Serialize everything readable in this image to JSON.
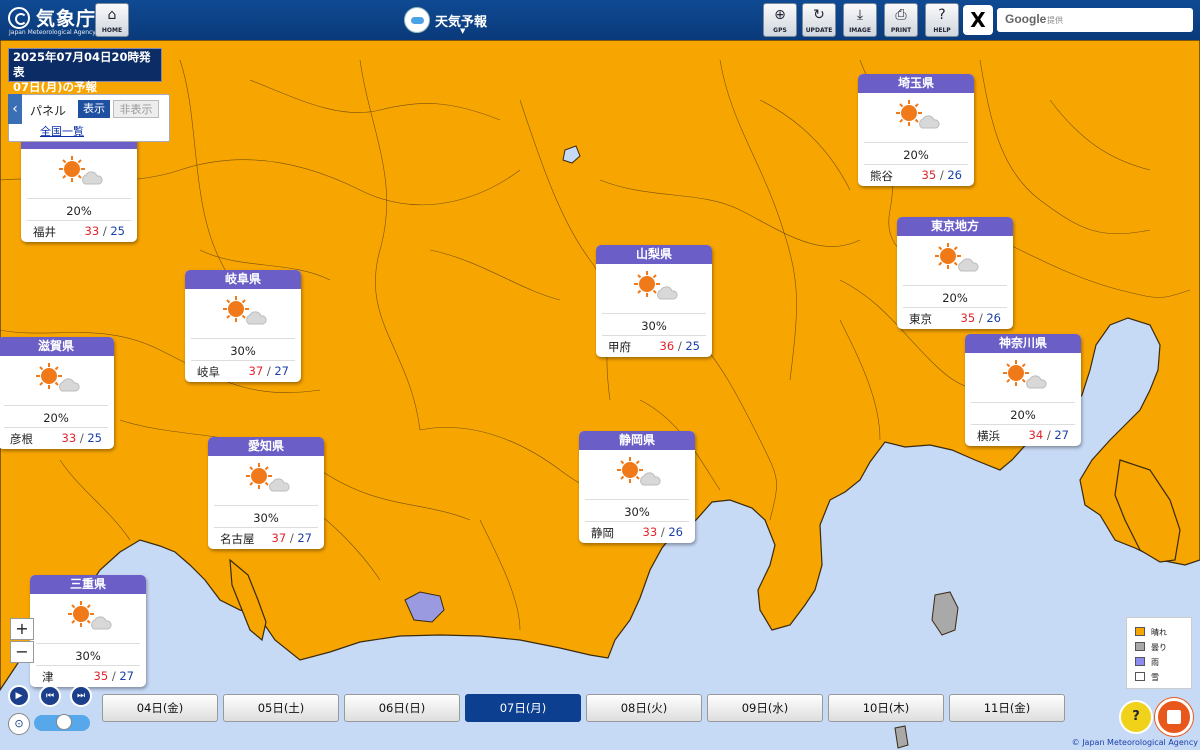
{
  "header": {
    "logo_jp": "気象庁",
    "logo_en": "Japan Meteorological Agency",
    "forecast_title": "天気予報",
    "tools": [
      {
        "label": "HOME",
        "icon": "home-icon",
        "glyph": "⌂"
      },
      {
        "label": "GPS",
        "icon": "gps-icon",
        "glyph": "⊕"
      },
      {
        "label": "UPDATE",
        "icon": "update-icon",
        "glyph": "↻"
      },
      {
        "label": "IMAGE",
        "icon": "download-icon",
        "glyph": "⤓"
      },
      {
        "label": "PRINT",
        "icon": "print-icon",
        "glyph": "⎙"
      },
      {
        "label": "HELP",
        "icon": "help-icon",
        "glyph": "?"
      }
    ],
    "x_label": "X",
    "search_brand": "Google",
    "search_sub": "提供"
  },
  "issued": {
    "line1": "2025年07月04日20時発表",
    "line2": "07日(月)の予報"
  },
  "panel": {
    "label": "パネル",
    "show": "表示",
    "hide": "非表示",
    "list_link": "全国一覧",
    "collapse_glyph": "‹"
  },
  "cards": [
    {
      "pref": "",
      "city": "福井",
      "pop": "20%",
      "max": "33",
      "min": "25",
      "weather": "sunny-partly-cloudy"
    },
    {
      "pref": "埼玉県",
      "city": "熊谷",
      "pop": "20%",
      "max": "35",
      "min": "26",
      "weather": "sunny-partly-cloudy"
    },
    {
      "pref": "東京地方",
      "city": "東京",
      "pop": "20%",
      "max": "35",
      "min": "26",
      "weather": "sunny-partly-cloudy"
    },
    {
      "pref": "山梨県",
      "city": "甲府",
      "pop": "30%",
      "max": "36",
      "min": "25",
      "weather": "sunny-partly-cloudy"
    },
    {
      "pref": "岐阜県",
      "city": "岐阜",
      "pop": "30%",
      "max": "37",
      "min": "27",
      "weather": "sunny-partly-cloudy"
    },
    {
      "pref": "滋賀県",
      "city": "彦根",
      "pop": "20%",
      "max": "33",
      "min": "25",
      "weather": "sunny-partly-cloudy"
    },
    {
      "pref": "神奈川県",
      "city": "横浜",
      "pop": "20%",
      "max": "34",
      "min": "27",
      "weather": "sunny-partly-cloudy"
    },
    {
      "pref": "静岡県",
      "city": "静岡",
      "pop": "30%",
      "max": "33",
      "min": "26",
      "weather": "sunny-partly-cloudy"
    },
    {
      "pref": "愛知県",
      "city": "名古屋",
      "pop": "30%",
      "max": "37",
      "min": "27",
      "weather": "sunny-partly-cloudy"
    },
    {
      "pref": "三重県",
      "city": "津",
      "pop": "30%",
      "max": "35",
      "min": "27",
      "weather": "sunny-partly-cloudy"
    }
  ],
  "temp_separator": "/",
  "zoom": {
    "in": "+",
    "out": "−"
  },
  "playback": {
    "play": "▶",
    "prev": "⏮",
    "next": "⏭"
  },
  "date_tabs": [
    {
      "label": "04日(金)",
      "active": false
    },
    {
      "label": "05日(土)",
      "active": false
    },
    {
      "label": "06日(日)",
      "active": false
    },
    {
      "label": "07日(月)",
      "active": true
    },
    {
      "label": "08日(火)",
      "active": false
    },
    {
      "label": "09日(水)",
      "active": false
    },
    {
      "label": "10日(木)",
      "active": false
    },
    {
      "label": "11日(金)",
      "active": false
    }
  ],
  "legend": [
    {
      "label": "晴れ",
      "color": "#f7a500"
    },
    {
      "label": "曇り",
      "color": "#a9a9a9"
    },
    {
      "label": "雨",
      "color": "#8c8cf0"
    },
    {
      "label": "雪",
      "color": "#ffffff"
    }
  ],
  "colors": {
    "land_sunny": "#f7a500",
    "sea": "#c6d9f5",
    "cloudy_land": "#a9a9a9",
    "card_header": "#6b5ec6",
    "temp_max": "#e0232a",
    "temp_min": "#1a3fa8",
    "header_bg": "#0f4a93",
    "active_tab": "#0c3f8f"
  },
  "copyright": "© Japan Meteorological Agency"
}
